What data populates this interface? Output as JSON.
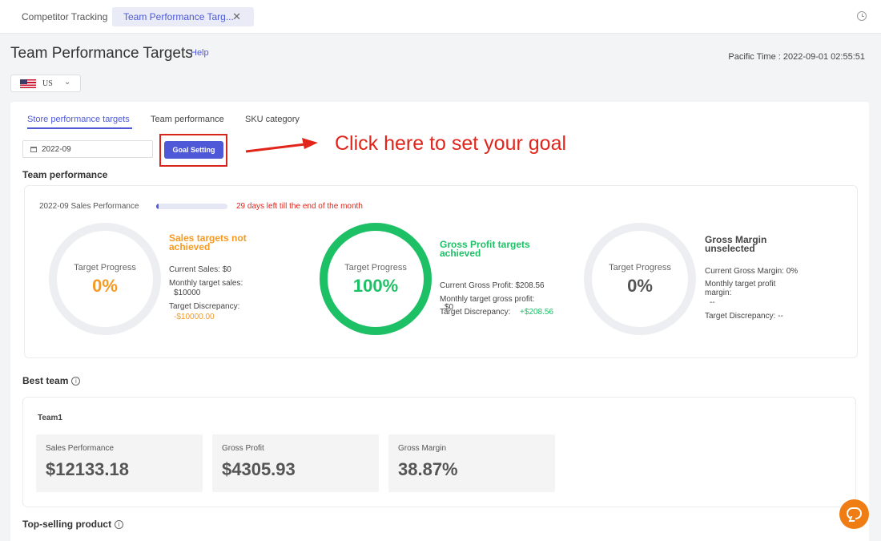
{
  "tabs": {
    "competitor_tracking": "Competitor Tracking",
    "team_perf_targets": "Team Performance Targ...",
    "close_symbol": "✕"
  },
  "page": {
    "title": "Team Performance Targets",
    "help": "Help",
    "pacific_time": "Pacific Time :  2022-09-01 02:55:51"
  },
  "country": {
    "label": "US",
    "flag_icon": "us-flag-icon"
  },
  "subtabs": [
    "Store performance targets",
    "Team performance",
    "SKU category"
  ],
  "date_value": "2022-09",
  "goal_button": "Goal Setting",
  "callout": "Click here to set your goal",
  "team_performance": {
    "title": "Team performance",
    "sales_label": "2022-09 Sales Performance",
    "month_progress": 0.03,
    "days_left": "29 days left till the end of the month",
    "rings": [
      {
        "label": "Target Progress",
        "value": "0%",
        "progress": 0,
        "value_color": "#f59a23",
        "status": "Sales targets not achieved",
        "status_color": "#f59a23",
        "lines": [
          "Current Sales:  $0",
          "Monthly target sales:",
          "$10000",
          "Target Discrepancy:",
          "-$10000.00"
        ]
      },
      {
        "label": "Target Progress",
        "value": "100%",
        "progress": 1,
        "value_color": "#1ec066",
        "status": "Gross Profit targets achieved",
        "status_color": "#1ec066",
        "lines": [
          "Current Gross Profit:   $208.56",
          "Monthly target gross profit:",
          "$0",
          "Target Discrepancy:",
          "+$208.56"
        ]
      },
      {
        "label": "Target Progress",
        "value": "0%",
        "progress": 0,
        "value_color": "#555555",
        "status": "Gross Margin unselected",
        "status_color": "#444444",
        "lines": [
          "Current Gross Margin:  0%",
          "Monthly target profit margin:",
          "--",
          "Target Discrepancy:  --"
        ]
      }
    ]
  },
  "best_team": {
    "title": "Best team",
    "info_icon": "i",
    "team": "Team1",
    "metrics": [
      {
        "label": "Sales Performance",
        "value": "$12133.18"
      },
      {
        "label": "Gross Profit",
        "value": "$4305.93"
      },
      {
        "label": "Gross Margin",
        "value": "38.87%"
      }
    ]
  },
  "top_selling": {
    "title": "Top-selling product"
  },
  "colors": {
    "accent": "#4f59d8",
    "red": "#e1251b",
    "orange": "#f59a23",
    "green": "#1ec066"
  }
}
